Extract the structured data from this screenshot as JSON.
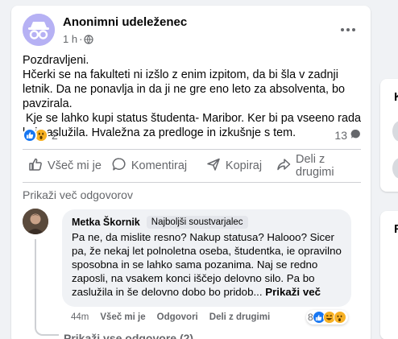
{
  "post": {
    "author": "Anonimni udeleženec",
    "time": "1 h",
    "separator": "·",
    "body": "Pozdravljeni.\nHčerki se na fakulteti ni izšlo z enim izpitom, da bi šla v zadnji letnik. Da ne ponavlja in da ji ne gre eno leto za absolventa, bo pavzirala.\n Kje se lahko kupi status študenta- Maribor. Ker bi pa vseeno rada kaj zaslužila. Hvaležna za predloge in izkušnje s tem.",
    "reaction_count": "2",
    "comment_count": "13",
    "actions": {
      "like": "Všeč mi je",
      "comment": "Komentiraj",
      "copy": "Kopiraj",
      "share": "Deli z drugimi"
    },
    "more_replies": "Prikaži več odgovorov"
  },
  "comment": {
    "author": "Metka Škornik",
    "badge": "Najboljši soustvarjalec",
    "text": "Pa ne, da mislite resno? Nakup statusa? Halooo? Sicer pa, že nekaj let polnoletna oseba, študentka, ie opravilno sposobna in se lahko sama pozanima. Naj se redno zaposli, na vsakem konci iščejo delovno silo. Pa bo zaslužila in še delovno dobo bo pridob...",
    "see_more": "Prikaži več",
    "time": "44m",
    "like": "Všeč mi je",
    "reply": "Odgovori",
    "share": "Deli z drugimi",
    "reaction_count": "8"
  },
  "all_replies": "Prikaži vse odgovore (2)",
  "side": {
    "letter1": "K",
    "letter2": "F"
  },
  "colors": {
    "like": "#1877f2",
    "wow": "#f7b125",
    "haha": "#f7b125",
    "muted": "#65676b"
  }
}
